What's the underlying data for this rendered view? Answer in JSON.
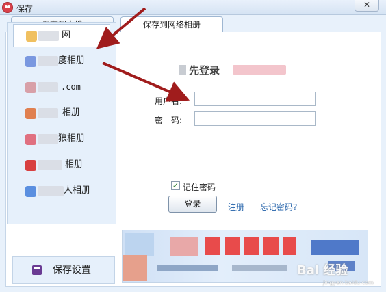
{
  "window": {
    "title": "保存",
    "close_label": "✕"
  },
  "tabs": [
    {
      "label": "保存到本地"
    },
    {
      "label": "保存到网络相册"
    }
  ],
  "sidebar": {
    "items": [
      {
        "label": "网",
        "icon_color": "#f0c060"
      },
      {
        "label": "度相册",
        "icon_color": "#7a98e0"
      },
      {
        "label": ".com",
        "icon_color": "#d8a0a8"
      },
      {
        "label": "相册",
        "icon_color": "#e08050"
      },
      {
        "label": "狼相册",
        "icon_color": "#e07080"
      },
      {
        "label": "相册",
        "icon_color": "#d84040"
      },
      {
        "label": "人相册",
        "icon_color": "#5a8fe0"
      }
    ]
  },
  "settings": {
    "label": "保存设置"
  },
  "login": {
    "title": "先登录",
    "username_label": "用户名:",
    "username_value": "",
    "password_label": "密　码:",
    "password_value": "",
    "remember_label": "记住密码",
    "remember_checked": true,
    "remember_mark": "✓",
    "login_button": "登录",
    "register_link": "注册",
    "forgot_link": "忘记密码?"
  },
  "banner": {
    "watermark": "Bai 经验",
    "watermark_url": "jingyan.baidu.com"
  },
  "colors": {
    "accent_link": "#1f5fa8",
    "arrow": "#a01c1c"
  }
}
